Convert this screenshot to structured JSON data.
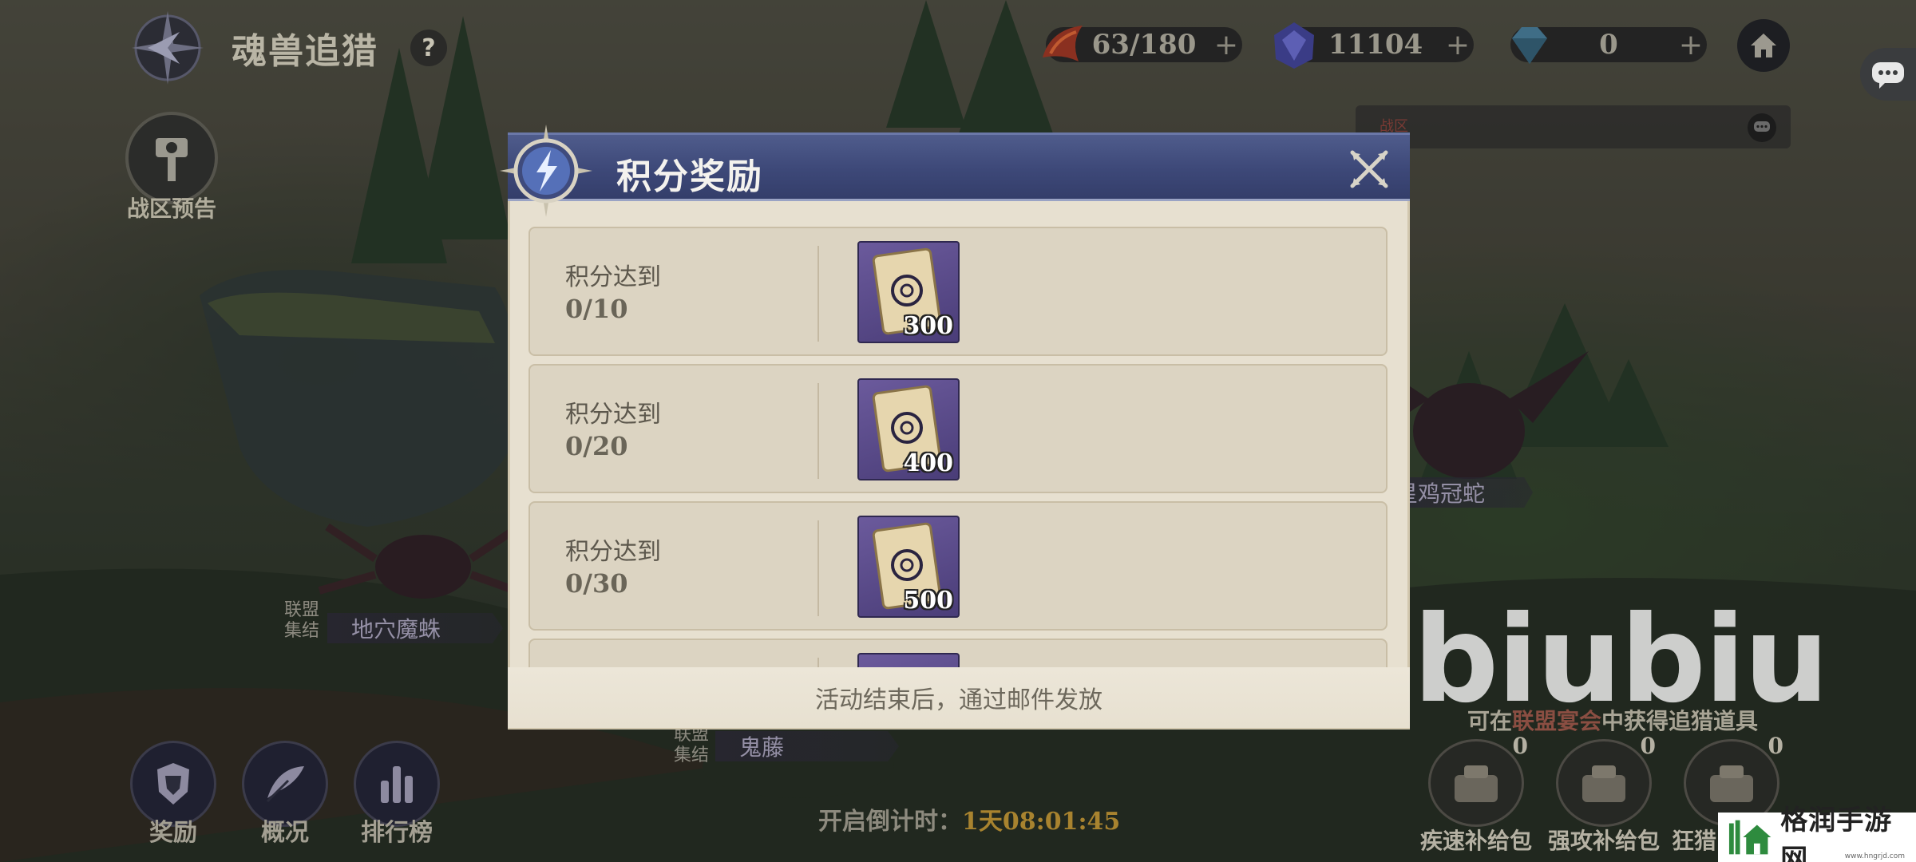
{
  "header": {
    "title": "魂兽追猎",
    "help_label": "?",
    "zone_preview_label": "战区预告"
  },
  "resources": [
    {
      "icon": "stamina-icon",
      "value": "63/180"
    },
    {
      "icon": "soul-crystal-icon",
      "value": "11104"
    },
    {
      "icon": "diamond-icon",
      "value": "0"
    }
  ],
  "chat": {
    "tag": "战区"
  },
  "map_labels": {
    "rally": "联盟\n集结",
    "monster_1": "地穴魔蛛",
    "monster_2": "鬼藤",
    "monster_3": "鸡冠蛇",
    "monster_3_prefix": "星"
  },
  "bottom_nav": [
    {
      "label": "奖励",
      "icon": "armor-icon"
    },
    {
      "label": "概况",
      "icon": "feather-icon"
    },
    {
      "label": "排行榜",
      "icon": "bar-chart-icon"
    }
  ],
  "countdown": {
    "label": "开启倒计时：",
    "time": "1天08:01:45"
  },
  "watermark": "biubiu",
  "hint": {
    "pre": "可在",
    "highlight": "联盟宴会",
    "post": "中获得追猎道具"
  },
  "supplies": [
    {
      "label": "疾速补给包",
      "count": "0"
    },
    {
      "label": "强攻补给包",
      "count": "0"
    },
    {
      "label": "狂猎",
      "count": "0"
    }
  ],
  "logo": {
    "text": "格润手游网",
    "url": "www.hngrjd.com"
  },
  "modal": {
    "title": "积分奖励",
    "rows": [
      {
        "requirement": "积分达到",
        "progress": "0/10",
        "reward_qty": "300"
      },
      {
        "requirement": "积分达到",
        "progress": "0/20",
        "reward_qty": "400"
      },
      {
        "requirement": "积分达到",
        "progress": "0/30",
        "reward_qty": "500"
      }
    ],
    "footer": "活动结束后，通过邮件发放"
  },
  "colors": {
    "modal_header": "#3d4878",
    "modal_body": "#e7e0d0",
    "row_bg": "#dcd4c2",
    "card": "#5b4d8a",
    "countdown_time": "#a8832f"
  }
}
